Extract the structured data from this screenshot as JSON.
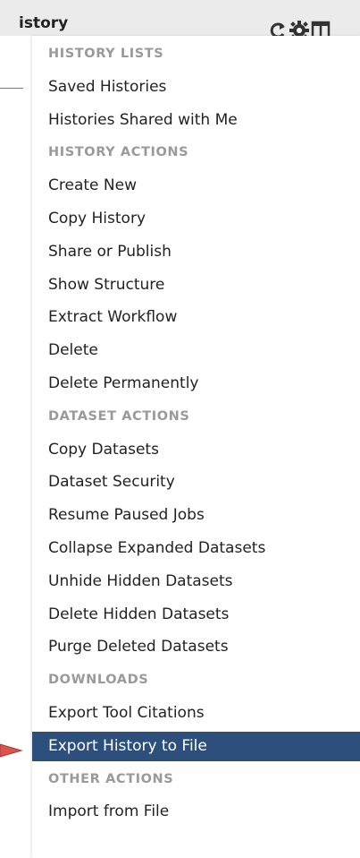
{
  "panel": {
    "title": "istory",
    "icons": [
      "refresh-icon",
      "gear-icon",
      "columns-icon"
    ]
  },
  "menu": {
    "items": [
      {
        "label": "HISTORY LISTS",
        "type": "header"
      },
      {
        "label": "Saved Histories",
        "type": "item"
      },
      {
        "label": "Histories Shared with Me",
        "type": "item"
      },
      {
        "label": "HISTORY ACTIONS",
        "type": "header"
      },
      {
        "label": "Create New",
        "type": "item"
      },
      {
        "label": "Copy History",
        "type": "item"
      },
      {
        "label": "Share or Publish",
        "type": "item"
      },
      {
        "label": "Show Structure",
        "type": "item"
      },
      {
        "label": "Extract Workflow",
        "type": "item"
      },
      {
        "label": "Delete",
        "type": "item"
      },
      {
        "label": "Delete Permanently",
        "type": "item"
      },
      {
        "label": "DATASET ACTIONS",
        "type": "header"
      },
      {
        "label": "Copy Datasets",
        "type": "item"
      },
      {
        "label": "Dataset Security",
        "type": "item"
      },
      {
        "label": "Resume Paused Jobs",
        "type": "item"
      },
      {
        "label": "Collapse Expanded Datasets",
        "type": "item"
      },
      {
        "label": "Unhide Hidden Datasets",
        "type": "item"
      },
      {
        "label": "Delete Hidden Datasets",
        "type": "item"
      },
      {
        "label": "Purge Deleted Datasets",
        "type": "item"
      },
      {
        "label": "DOWNLOADS",
        "type": "header"
      },
      {
        "label": "Export Tool Citations",
        "type": "item"
      },
      {
        "label": "Export History to File",
        "type": "item",
        "active": true
      },
      {
        "label": "OTHER ACTIONS",
        "type": "header"
      },
      {
        "label": "Import from File",
        "type": "item"
      }
    ]
  },
  "colors": {
    "active_bg": "#2c4f7c",
    "section_header": "#9a9a9a",
    "pointer": "#d9534f"
  }
}
